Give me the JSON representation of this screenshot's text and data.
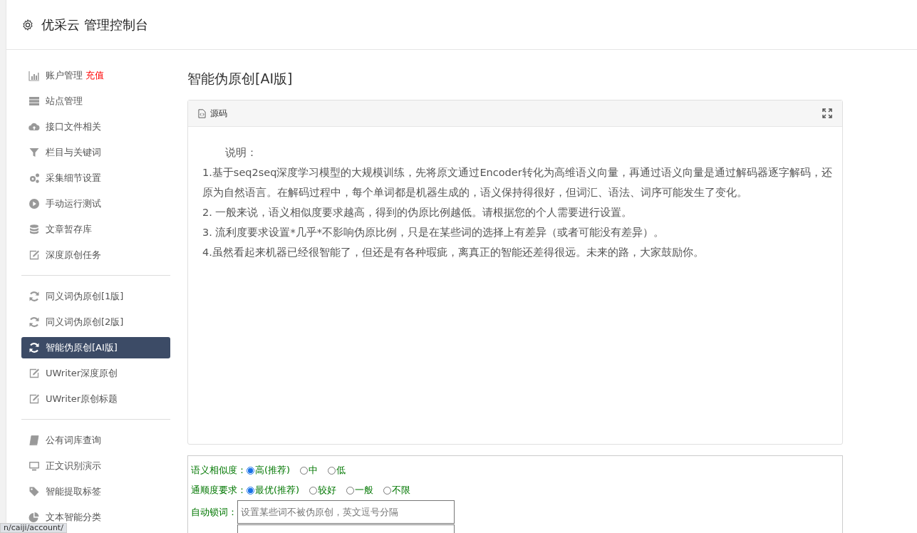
{
  "header": {
    "title": "优采云 管理控制台"
  },
  "sidebar": {
    "groups": [
      {
        "items": [
          {
            "label": "账户管理",
            "badge": "充值",
            "selected": false
          },
          {
            "label": "站点管理",
            "selected": false
          },
          {
            "label": "接口文件相关",
            "selected": false
          },
          {
            "label": "栏目与关键词",
            "selected": false
          },
          {
            "label": "采集细节设置",
            "selected": false
          },
          {
            "label": "手动运行测试",
            "selected": false
          },
          {
            "label": "文章暂存库",
            "selected": false
          },
          {
            "label": "深度原创任务",
            "selected": false
          }
        ]
      },
      {
        "items": [
          {
            "label": "同义词伪原创[1版]",
            "selected": false
          },
          {
            "label": "同义词伪原创[2版]",
            "selected": false
          },
          {
            "label": "智能伪原创[AI版]",
            "selected": true
          },
          {
            "label": "UWriter深度原创",
            "selected": false
          },
          {
            "label": "UWriter原创标题",
            "selected": false
          }
        ]
      },
      {
        "items": [
          {
            "label": "公有词库查询",
            "selected": false
          },
          {
            "label": "正文识别演示",
            "selected": false
          },
          {
            "label": "智能提取标签",
            "selected": false
          },
          {
            "label": "文本智能分类",
            "selected": false
          }
        ]
      }
    ]
  },
  "page_title": "智能伪原创[AI版]",
  "editor": {
    "tab": "源码",
    "intro": "说明：",
    "paragraphs": [
      "1.基于seq2seq深度学习模型的大规模训练，先将原文通过Encoder转化为高维语义向量，再通过语义向量是通过解码器逐字解码，还原为自然语言。在解码过程中，每个单词都是机器生成的，语义保持得很好，但词汇、语法、词序可能发生了变化。",
      "2. 一般来说，语义相似度要求越高，得到的伪原比例越低。请根据您的个人需要进行设置。",
      "3. 流利度要求设置*几乎*不影响伪原比例，只是在某些词的选择上有差异（或者可能没有差异）。",
      "4.虽然看起来机器已经很智能了，但还是有各种瑕疵，离真正的智能还差得很远。未来的路，大家鼓励你。"
    ]
  },
  "options": [
    {
      "label": "语义相似度：",
      "choices": [
        {
          "label": "高(推荐)",
          "selected": true
        },
        {
          "label": "中",
          "selected": false
        },
        {
          "label": "低",
          "selected": false
        }
      ]
    },
    {
      "label": "通顺度要求：",
      "choices": [
        {
          "label": "最优(推荐)",
          "selected": true
        },
        {
          "label": "较好",
          "selected": false
        },
        {
          "label": "一般",
          "selected": false
        },
        {
          "label": "不限",
          "selected": false
        }
      ]
    }
  ],
  "lock_words": {
    "label": "自动锁词：",
    "placeholder": "设置某些词不被伪原创，英文逗号分隔"
  },
  "status_url": "n/caiji/account/"
}
